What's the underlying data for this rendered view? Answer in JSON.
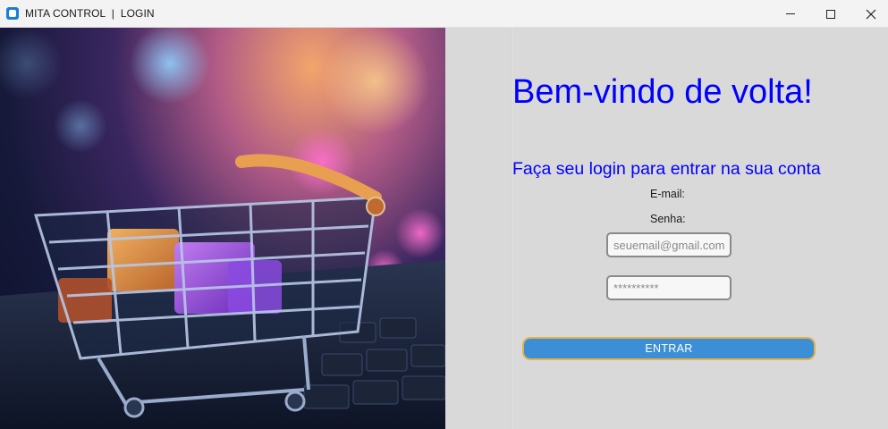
{
  "window": {
    "title": "MITA CONTROL  |  LOGIN",
    "controls": [
      "minimize-icon",
      "maximize-icon",
      "close-icon"
    ]
  },
  "hero": {
    "image": "shopping-cart-on-laptop-photo"
  },
  "login": {
    "heading": "Bem-vindo de volta!",
    "subheading": "Faça seu login para entrar na sua conta",
    "email_label": "E-mail:",
    "password_label": "Senha:",
    "email_placeholder": "seuemail@gmail.com",
    "password_placeholder": "**********",
    "submit_label": "ENTRAR"
  },
  "colors": {
    "heading": "#0000ff",
    "button_fill": "#3c8fd6",
    "button_border": "#e6b04a",
    "panel_background": "#d9d9d9",
    "app_icon": "#1a7fd4"
  }
}
